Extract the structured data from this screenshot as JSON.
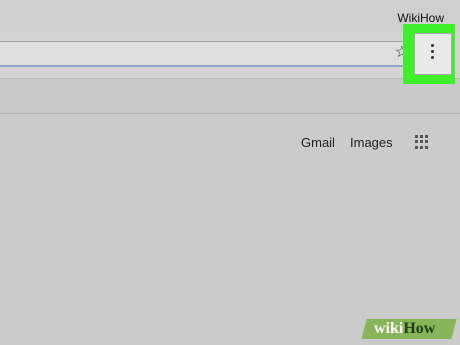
{
  "browser": {
    "profile_name": "WikiHow",
    "icons": {
      "bookmark": "star-icon",
      "menu": "kebab-menu-icon",
      "apps": "apps-grid-icon"
    },
    "highlight_color": "#3ef02a"
  },
  "google_header": {
    "gmail_label": "Gmail",
    "images_label": "Images"
  },
  "watermark": {
    "wiki": "wiki",
    "how": "How"
  }
}
